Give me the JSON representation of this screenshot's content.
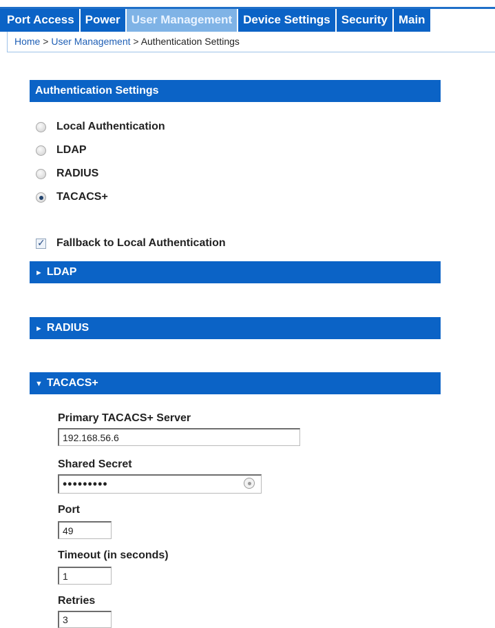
{
  "nav": {
    "tabs": [
      {
        "label": "Port Access",
        "active": false
      },
      {
        "label": "Power",
        "active": false
      },
      {
        "label": "User Management",
        "active": true
      },
      {
        "label": "Device Settings",
        "active": false
      },
      {
        "label": "Security",
        "active": false
      },
      {
        "label": "Main",
        "active": false
      }
    ]
  },
  "breadcrumb": {
    "home": "Home",
    "separator": ">",
    "section": "User Management",
    "current": "Authentication Settings"
  },
  "auth": {
    "title": "Authentication Settings",
    "options": [
      {
        "label": "Local Authentication",
        "checked": false
      },
      {
        "label": "LDAP",
        "checked": false
      },
      {
        "label": "RADIUS",
        "checked": false
      },
      {
        "label": "TACACS+",
        "checked": true
      }
    ],
    "fallback_label": "Fallback to Local Authentication",
    "fallback_checked": true,
    "check_glyph": "✓"
  },
  "sections": {
    "ldap": {
      "arrow": "►",
      "title": "LDAP",
      "expanded": false
    },
    "radius": {
      "arrow": "►",
      "title": "RADIUS",
      "expanded": false
    },
    "tacacs": {
      "arrow": "▼",
      "title": "TACACS+",
      "expanded": true
    }
  },
  "tacacs_form": {
    "primary_server_label": "Primary TACACS+ Server",
    "primary_server_value": "192.168.56.6",
    "shared_secret_label": "Shared Secret",
    "shared_secret_value": "•••••••••",
    "port_label": "Port",
    "port_value": "49",
    "timeout_label": "Timeout (in seconds)",
    "timeout_value": "1",
    "retries_label": "Retries",
    "retries_value": "3"
  },
  "colors": {
    "accent": "#0b63c6",
    "active_tab": "#7fb3e6",
    "link": "#1f5fb5"
  }
}
